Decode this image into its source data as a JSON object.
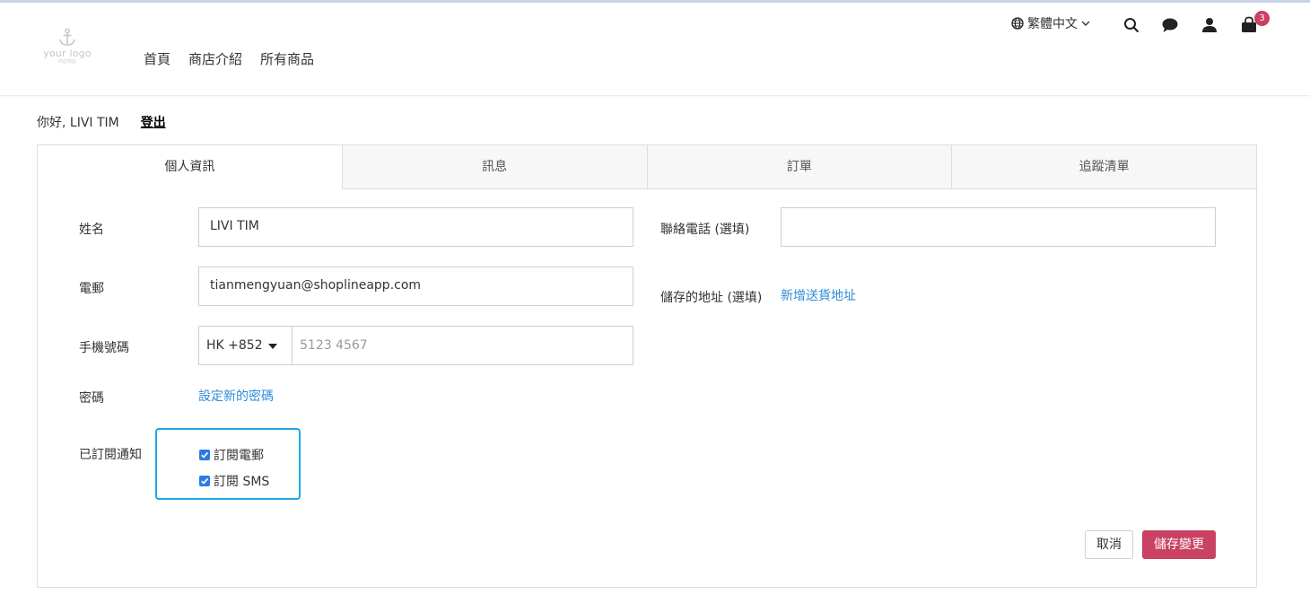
{
  "header": {
    "logo_text": "your logo",
    "logo_subtext": "商店標語",
    "nav": [
      {
        "label": "首頁"
      },
      {
        "label": "商店介紹"
      },
      {
        "label": "所有商品"
      }
    ],
    "language": "繁體中文",
    "cart_count": "3"
  },
  "greeting": {
    "text": "你好, LIVI TIM",
    "logout": "登出"
  },
  "tabs": [
    {
      "label": "個人資訊",
      "active": true
    },
    {
      "label": "訊息"
    },
    {
      "label": "訂單"
    },
    {
      "label": "追蹤清單"
    }
  ],
  "form": {
    "name_label": "姓名",
    "name_value": "LIVI TIM",
    "email_label": "電郵",
    "email_value": "tianmengyuan@shoplineapp.com",
    "mobile_label": "手機號碼",
    "country_code": "HK +852",
    "mobile_placeholder": "5123 4567",
    "password_label": "密碼",
    "password_link": "設定新的密碼",
    "subscribe_label": "已訂閱通知",
    "subscribe_email": "訂閱電郵",
    "subscribe_sms": "訂閱 SMS",
    "phone_label": "聯絡電話 (選填)",
    "phone_value": "",
    "address_label": "儲存的地址 (選填)",
    "address_link": "新增送貨地址"
  },
  "buttons": {
    "cancel": "取消",
    "save": "儲存變更"
  },
  "colors": {
    "accent": "#c94163",
    "link": "#2f8bd8",
    "highlight": "#20a8e6",
    "checkbox": "#2a7be4"
  }
}
